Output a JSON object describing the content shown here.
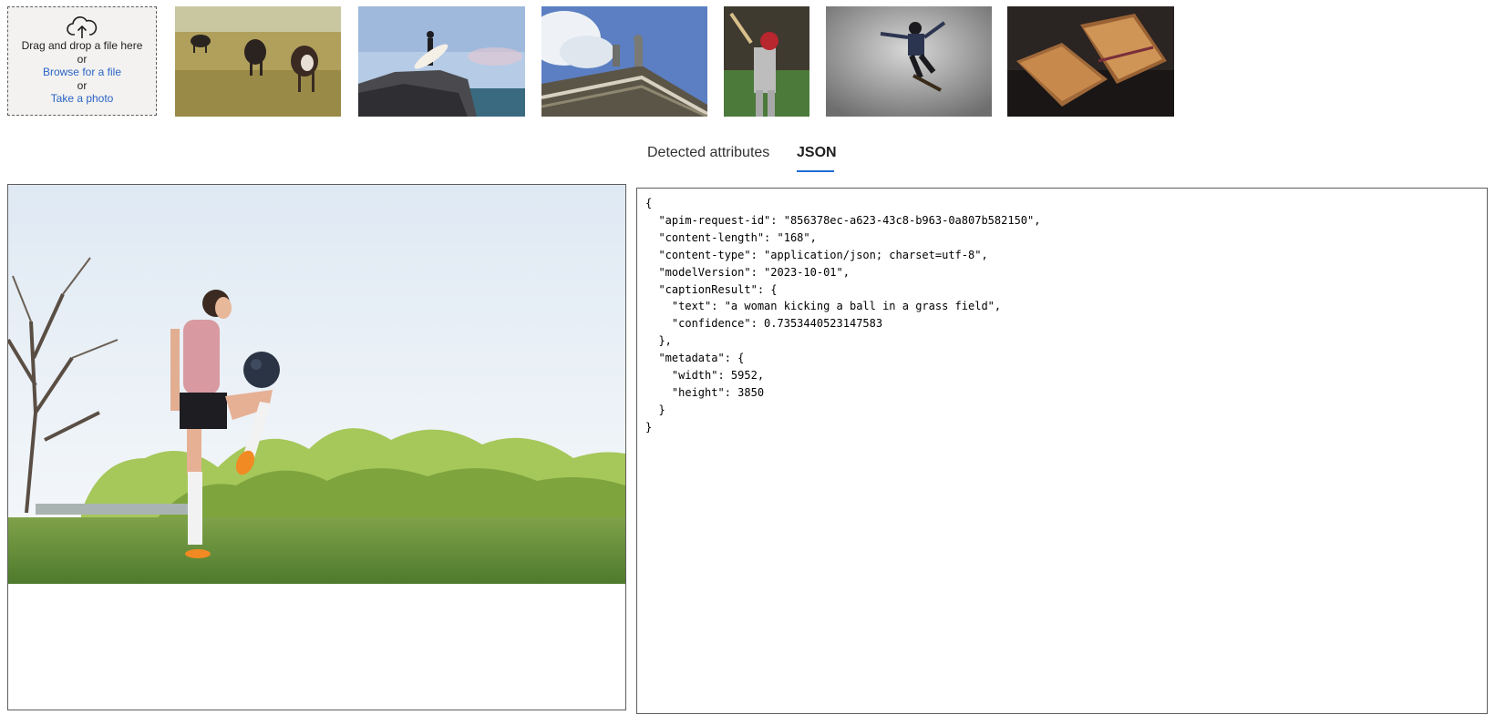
{
  "upload": {
    "drag_text": "Drag and drop a file here",
    "or_1": "or",
    "browse_label": "Browse for a file",
    "or_2": "or",
    "photo_label": "Take a photo",
    "icon": "cloud-upload-icon"
  },
  "thumbnails": [
    {
      "name": "cows-in-field"
    },
    {
      "name": "surfer-on-cliff"
    },
    {
      "name": "building-statues"
    },
    {
      "name": "baseball-batter"
    },
    {
      "name": "skateboarder"
    },
    {
      "name": "sandwich"
    }
  ],
  "tabs": [
    {
      "label": "Detected attributes",
      "active": false
    },
    {
      "label": "JSON",
      "active": true
    }
  ],
  "accent_color": "#1f6ed4",
  "link_color": "#2b64c5",
  "json_text": "{\n  \"apim-request-id\": \"856378ec-a623-43c8-b963-0a807b582150\",\n  \"content-length\": \"168\",\n  \"content-type\": \"application/json; charset=utf-8\",\n  \"modelVersion\": \"2023-10-01\",\n  \"captionResult\": {\n    \"text\": \"a woman kicking a ball in a grass field\",\n    \"confidence\": 0.7353440523147583\n  },\n  \"metadata\": {\n    \"width\": 5952,\n    \"height\": 3850\n  }\n}"
}
